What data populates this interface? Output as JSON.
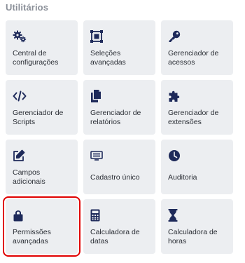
{
  "section": {
    "title": "Utilitários"
  },
  "colors": {
    "icon": "#1e2a5a",
    "tile_bg": "#eceef1",
    "highlight": "#e00000"
  },
  "tiles": [
    {
      "label": "Central de\nconfigurações",
      "icon": "gears-icon"
    },
    {
      "label": "Seleções\navançadas",
      "icon": "selection-icon"
    },
    {
      "label": "Gerenciador de\nacessos",
      "icon": "key-icon"
    },
    {
      "label": "Gerenciador de\nScripts",
      "icon": "code-icon"
    },
    {
      "label": "Gerenciador de\nrelatórios",
      "icon": "copy-icon"
    },
    {
      "label": "Gerenciador de\nextensões",
      "icon": "puzzle-icon"
    },
    {
      "label": "Campos\nadicionais",
      "icon": "edit-icon"
    },
    {
      "label": "Cadastro único",
      "icon": "id-card-icon"
    },
    {
      "label": "Auditoria",
      "icon": "clock-icon"
    },
    {
      "label": "Permissões\navançadas",
      "icon": "lock-icon",
      "selected": true
    },
    {
      "label": "Calculadora de\ndatas",
      "icon": "calculator-icon"
    },
    {
      "label": "Calculadora de\nhoras",
      "icon": "hourglass-icon"
    }
  ]
}
